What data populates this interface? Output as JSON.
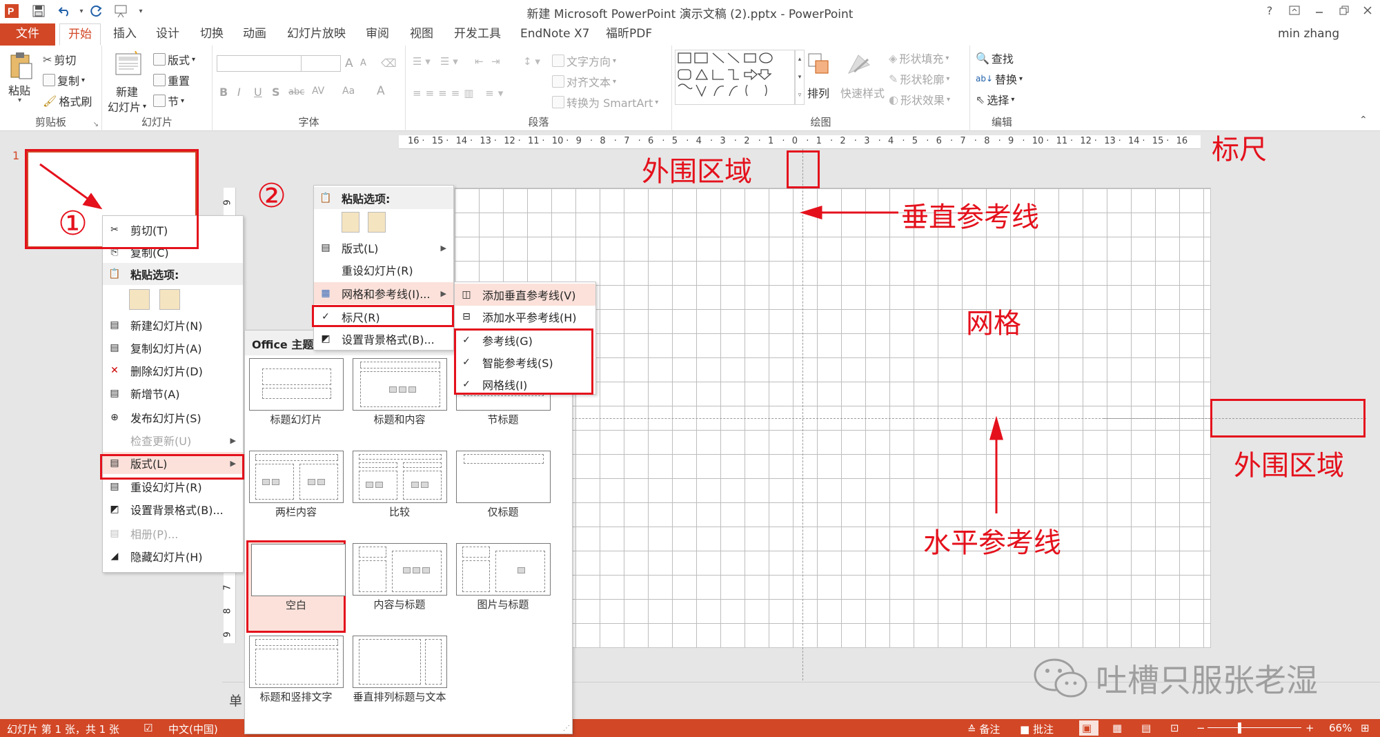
{
  "window": {
    "title": "新建 Microsoft PowerPoint 演示文稿 (2).pptx - PowerPoint",
    "help_glyph": "?",
    "user": "min zhang"
  },
  "tabs": [
    "文件",
    "开始",
    "插入",
    "设计",
    "切换",
    "动画",
    "幻灯片放映",
    "审阅",
    "视图",
    "开发工具",
    "EndNote X7",
    "福昕PDF"
  ],
  "ribbon": {
    "clipboard": {
      "label": "剪贴板",
      "paste": "粘贴",
      "cut": "剪切",
      "copy": "复制",
      "format_painter": "格式刷"
    },
    "slides": {
      "label": "幻灯片",
      "new_slide_1": "新建",
      "new_slide_2": "幻灯片",
      "layout": "版式",
      "reset": "重置",
      "section": "节"
    },
    "font": {
      "label": "字体",
      "grow": "A",
      "shrink": "A",
      "bold": "B",
      "italic": "I",
      "underline": "U",
      "shadow": "S",
      "strike": "abc",
      "spacing": "AV",
      "case": "Aa",
      "color": "A"
    },
    "paragraph": {
      "label": "段落",
      "text_direction": "文字方向",
      "align_text": "对齐文本",
      "smartart": "转换为 SmartArt"
    },
    "drawing": {
      "label": "绘图",
      "arrange": "排列",
      "quick_styles": "快速样式",
      "shape_fill": "形状填充",
      "shape_outline": "形状轮廓",
      "shape_effects": "形状效果"
    },
    "editing": {
      "label": "编辑",
      "find": "查找",
      "replace": "替换",
      "select": "选择"
    }
  },
  "ruler": {
    "h_ticks": [
      "16",
      "15",
      "14",
      "13",
      "12",
      "11",
      "10",
      "9",
      "8",
      "7",
      "6",
      "5",
      "4",
      "3",
      "2",
      "1",
      "0",
      "1",
      "2",
      "3",
      "4",
      "5",
      "6",
      "7",
      "8",
      "9",
      "10",
      "11",
      "12",
      "13",
      "14",
      "15",
      "16"
    ],
    "v_ticks": [
      "9",
      "7",
      "8",
      "9"
    ]
  },
  "thumbnail": {
    "number": "1"
  },
  "context_menu_1": {
    "items": [
      {
        "label": "剪切(T)",
        "icon": "scissors-icon"
      },
      {
        "label": "复制(C)",
        "icon": "copy-icon"
      },
      {
        "label": "粘贴选项:",
        "icon": "paste-icon"
      },
      {
        "label": "新建幻灯片(N)",
        "icon": "new-slide-icon"
      },
      {
        "label": "复制幻灯片(A)",
        "icon": "duplicate-slide-icon"
      },
      {
        "label": "删除幻灯片(D)",
        "icon": "delete-slide-icon"
      },
      {
        "label": "新增节(A)",
        "icon": "section-icon"
      },
      {
        "label": "发布幻灯片(S)",
        "icon": "publish-icon"
      },
      {
        "label": "检查更新(U)",
        "icon": ""
      },
      {
        "label": "版式(L)",
        "icon": "layout-icon"
      },
      {
        "label": "重设幻灯片(R)",
        "icon": "reset-icon"
      },
      {
        "label": "设置背景格式(B)...",
        "icon": "background-icon"
      },
      {
        "label": "相册(P)...",
        "icon": "album-icon"
      },
      {
        "label": "隐藏幻灯片(H)",
        "icon": "hide-slide-icon"
      }
    ]
  },
  "context_menu_2": {
    "items": [
      {
        "label": "粘贴选项:"
      },
      {
        "label": "版式(L)"
      },
      {
        "label": "重设幻灯片(R)"
      },
      {
        "label": "网格和参考线(I)..."
      },
      {
        "label": "标尺(R)",
        "checked": true
      },
      {
        "label": "设置背景格式(B)..."
      }
    ]
  },
  "grid_submenu": {
    "items": [
      {
        "label": "添加垂直参考线(V)"
      },
      {
        "label": "添加水平参考线(H)"
      },
      {
        "label": "参考线(G)",
        "checked": true
      },
      {
        "label": "智能参考线(S)",
        "checked": true
      },
      {
        "label": "网格线(I)",
        "checked": true
      }
    ]
  },
  "layout_gallery": {
    "header": "Office 主题",
    "layouts": [
      {
        "name": "标题幻灯片",
        "selected": false
      },
      {
        "name": "标题和内容",
        "selected": false
      },
      {
        "name": "节标题",
        "selected": false
      },
      {
        "name": "两栏内容",
        "selected": false
      },
      {
        "name": "比较",
        "selected": false
      },
      {
        "name": "仅标题",
        "selected": false
      },
      {
        "name": "空白",
        "selected": true
      },
      {
        "name": "内容与标题",
        "selected": false
      },
      {
        "name": "图片与标题",
        "selected": false
      },
      {
        "name": "标题和竖排文字",
        "selected": false
      },
      {
        "name": "垂直排列标题与文本",
        "selected": false
      }
    ]
  },
  "annotations": {
    "circle1": "①",
    "circle2": "②",
    "outer_area_top": "外围区域",
    "ruler": "标尺",
    "vertical_guide": "垂直参考线",
    "grid": "网格",
    "horizontal_guide": "水平参考线",
    "outer_area_right": "外围区域",
    "watermark": "吐槽只服张老湿"
  },
  "notes": {
    "placeholder": "单"
  },
  "status": {
    "slide_info": "幻灯片 第 1 张，共 1 张",
    "language": "中文(中国)",
    "notes": "备注",
    "comments": "批注",
    "zoom": "66%"
  },
  "colors": {
    "accent": "#d24726",
    "annotation_red": "#e4111c",
    "highlight": "#fbe1da"
  }
}
